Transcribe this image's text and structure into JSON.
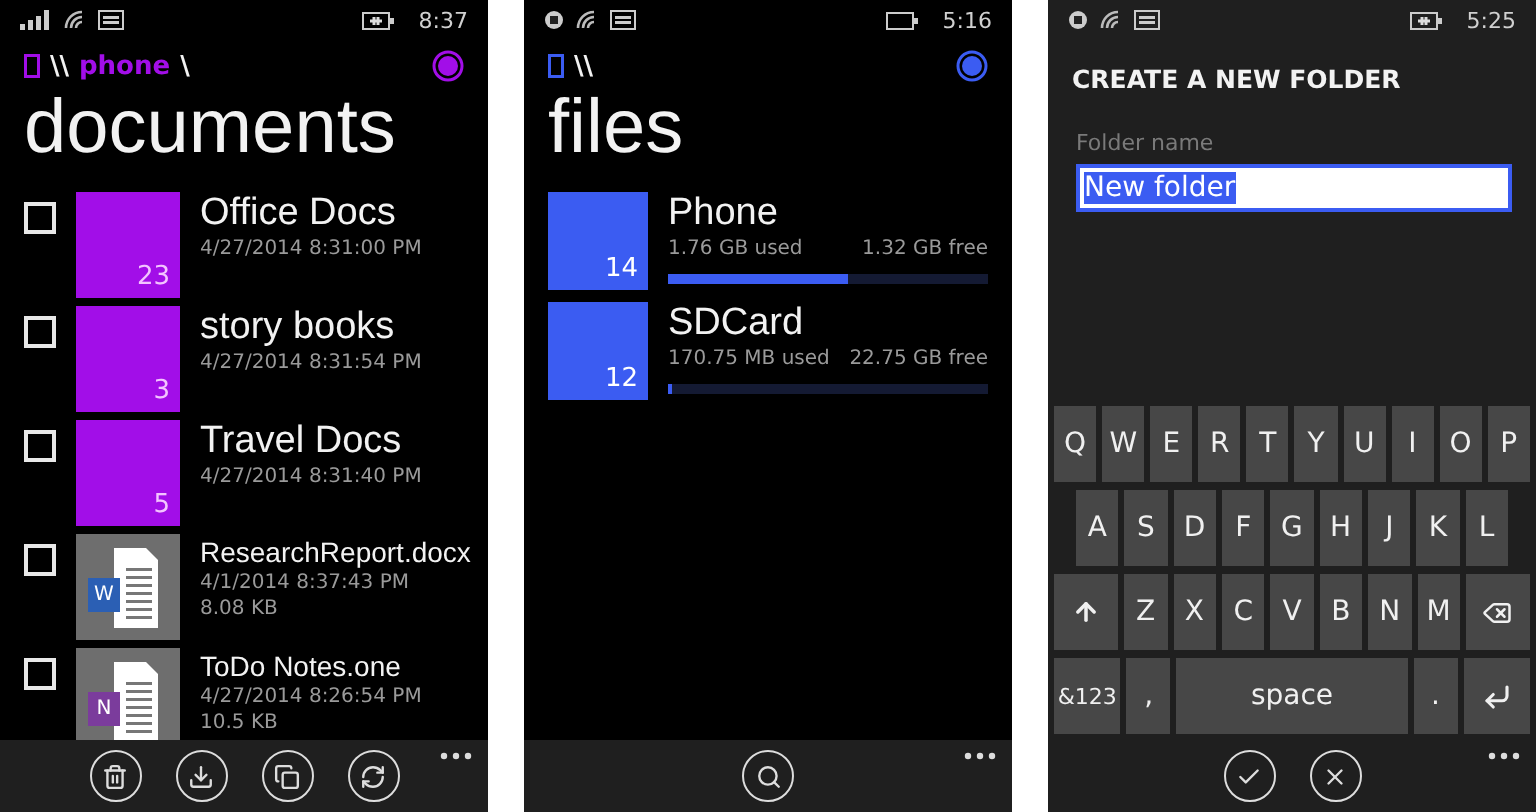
{
  "screens": [
    {
      "kind": "documents",
      "status": {
        "signal": true,
        "charging": true,
        "time": "8:37"
      },
      "breadcrumb": {
        "root": "\\\\",
        "folder": "phone",
        "separator": "\\"
      },
      "title": "documents",
      "items": [
        {
          "kind": "folder",
          "checked": false,
          "name": "Office Docs",
          "date": "4/27/2014 8:31:00 PM",
          "count": "23"
        },
        {
          "kind": "folder",
          "checked": false,
          "name": "story books",
          "date": "4/27/2014 8:31:54 PM",
          "count": "3"
        },
        {
          "kind": "folder",
          "checked": false,
          "name": "Travel Docs",
          "date": "4/27/2014 8:31:40 PM",
          "count": "5"
        },
        {
          "kind": "word",
          "checked": false,
          "name": "ResearchReport.docx",
          "date": "4/1/2014 8:37:43 PM",
          "size": "8.08 KB",
          "badge": "W"
        },
        {
          "kind": "onenote",
          "checked": false,
          "name": "ToDo Notes.one",
          "date": "4/27/2014 8:26:54 PM",
          "size": "10.5 KB",
          "badge": "N"
        }
      ],
      "app_bar": [
        {
          "kind": "delete"
        },
        {
          "kind": "download"
        },
        {
          "kind": "copy"
        },
        {
          "kind": "sync"
        }
      ]
    },
    {
      "kind": "files",
      "status": {
        "signal": false,
        "charging": false,
        "time": "5:16"
      },
      "breadcrumb": {
        "root": "\\\\"
      },
      "title": "files",
      "drives": [
        {
          "name": "Phone",
          "count": "14",
          "used": "1.76 GB used",
          "free": "1.32 GB free",
          "level": 0.56
        },
        {
          "name": "SDCard",
          "count": "12",
          "used": "170.75 MB used",
          "free": "22.75 GB free",
          "level": 0.01
        }
      ],
      "app_bar": [
        {
          "kind": "search"
        }
      ]
    },
    {
      "kind": "create_folder",
      "status": {
        "signal": false,
        "charging": true,
        "time": "5:25"
      },
      "title": "CREATE A NEW FOLDER",
      "field": {
        "label": "Folder name",
        "value": "New folder",
        "selected": true
      },
      "keyboard": [
        [
          {
            "kind": "char",
            "label": "Q"
          },
          {
            "kind": "char",
            "label": "W"
          },
          {
            "kind": "char",
            "label": "E"
          },
          {
            "kind": "char",
            "label": "R"
          },
          {
            "kind": "char",
            "label": "T"
          },
          {
            "kind": "char",
            "label": "Y"
          },
          {
            "kind": "char",
            "label": "U"
          },
          {
            "kind": "char",
            "label": "I"
          },
          {
            "kind": "char",
            "label": "O"
          },
          {
            "kind": "char",
            "label": "P"
          }
        ],
        [
          {
            "kind": "char",
            "label": "A"
          },
          {
            "kind": "char",
            "label": "S"
          },
          {
            "kind": "char",
            "label": "D"
          },
          {
            "kind": "char",
            "label": "F"
          },
          {
            "kind": "char",
            "label": "G"
          },
          {
            "kind": "char",
            "label": "H"
          },
          {
            "kind": "char",
            "label": "J"
          },
          {
            "kind": "char",
            "label": "K"
          },
          {
            "kind": "char",
            "label": "L"
          }
        ],
        [
          {
            "kind": "shift"
          },
          {
            "kind": "char",
            "label": "Z"
          },
          {
            "kind": "char",
            "label": "X"
          },
          {
            "kind": "char",
            "label": "C"
          },
          {
            "kind": "char",
            "label": "V"
          },
          {
            "kind": "char",
            "label": "B"
          },
          {
            "kind": "char",
            "label": "N"
          },
          {
            "kind": "char",
            "label": "M"
          },
          {
            "kind": "backspace"
          }
        ],
        [
          {
            "kind": "symbols",
            "label": "&123"
          },
          {
            "kind": "char",
            "label": ","
          },
          {
            "kind": "space",
            "label": "space"
          },
          {
            "kind": "char",
            "label": "."
          },
          {
            "kind": "enter"
          }
        ]
      ],
      "app_bar": [
        {
          "kind": "accept"
        },
        {
          "kind": "cancel"
        }
      ]
    }
  ]
}
